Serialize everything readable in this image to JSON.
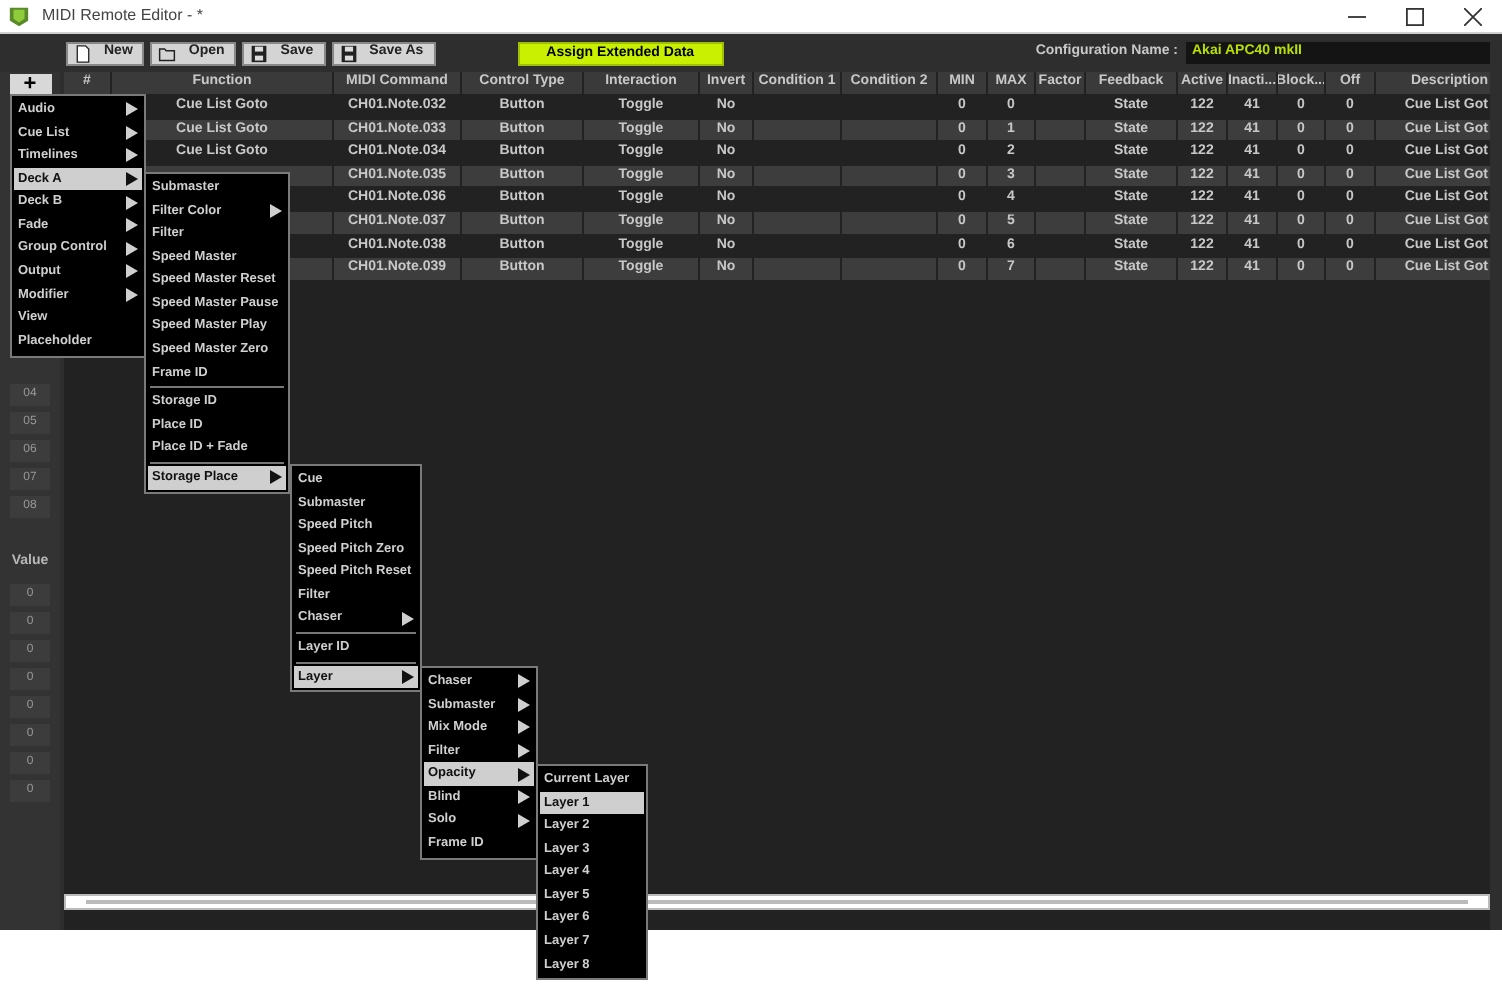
{
  "window": {
    "title": "MIDI Remote Editor - *"
  },
  "toolbar": {
    "buttons": [
      {
        "label": "New"
      },
      {
        "label": "Open"
      },
      {
        "label": "Save"
      },
      {
        "label": "Save As"
      }
    ],
    "assign_button": "Assign Extended Data",
    "configuration_label": "Configuration Name :",
    "configuration_value": "Akai APC40 mkII"
  },
  "add_button": "+",
  "row_numbers": [
    "04",
    "05",
    "06",
    "07",
    "08"
  ],
  "value_label": "Value",
  "values": [
    "0",
    "0",
    "0",
    "0",
    "0",
    "0",
    "0",
    "0"
  ],
  "table": {
    "columns": [
      "#",
      "Function",
      "MIDI Command",
      "Control Type",
      "Interaction",
      "Invert",
      "Condition 1",
      "Condition 2",
      "MIN",
      "MAX",
      "Factor",
      "Feedback",
      "Active",
      "Inacti...",
      "Block...",
      "Off",
      "Description"
    ],
    "rows": [
      {
        "function": "Cue List Goto",
        "midi": "CH01.Note.032",
        "control": "Button",
        "interaction": "Toggle",
        "invert": "No",
        "min": "0",
        "max": "0",
        "feedback": "State",
        "active": "122",
        "inactive": "41",
        "block": "0",
        "off": "0",
        "description": "Cue List Got"
      },
      {
        "function": "Cue List Goto",
        "midi": "CH01.Note.033",
        "control": "Button",
        "interaction": "Toggle",
        "invert": "No",
        "min": "0",
        "max": "1",
        "feedback": "State",
        "active": "122",
        "inactive": "41",
        "block": "0",
        "off": "0",
        "description": "Cue List Got"
      },
      {
        "function": "Cue List Goto",
        "midi": "CH01.Note.034",
        "control": "Button",
        "interaction": "Toggle",
        "invert": "No",
        "min": "0",
        "max": "2",
        "feedback": "State",
        "active": "122",
        "inactive": "41",
        "block": "0",
        "off": "0",
        "description": "Cue List Got"
      },
      {
        "midi": "CH01.Note.035",
        "control": "Button",
        "interaction": "Toggle",
        "invert": "No",
        "min": "0",
        "max": "3",
        "feedback": "State",
        "active": "122",
        "inactive": "41",
        "block": "0",
        "off": "0",
        "description": "Cue List Got"
      },
      {
        "midi": "CH01.Note.036",
        "control": "Button",
        "interaction": "Toggle",
        "invert": "No",
        "min": "0",
        "max": "4",
        "feedback": "State",
        "active": "122",
        "inactive": "41",
        "block": "0",
        "off": "0",
        "description": "Cue List Got"
      },
      {
        "midi": "CH01.Note.037",
        "control": "Button",
        "interaction": "Toggle",
        "invert": "No",
        "min": "0",
        "max": "5",
        "feedback": "State",
        "active": "122",
        "inactive": "41",
        "block": "0",
        "off": "0",
        "description": "Cue List Got"
      },
      {
        "midi": "CH01.Note.038",
        "control": "Button",
        "interaction": "Toggle",
        "invert": "No",
        "min": "0",
        "max": "6",
        "feedback": "State",
        "active": "122",
        "inactive": "41",
        "block": "0",
        "off": "0",
        "description": "Cue List Got"
      },
      {
        "midi": "CH01.Note.039",
        "control": "Button",
        "interaction": "Toggle",
        "invert": "No",
        "min": "0",
        "max": "7",
        "feedback": "State",
        "active": "122",
        "inactive": "41",
        "block": "0",
        "off": "0",
        "description": "Cue List Got"
      }
    ]
  },
  "menus": [
    {
      "items": [
        {
          "kind": "item",
          "label": "Audio",
          "submenu": true,
          "selected": false
        },
        {
          "kind": "item",
          "label": "Cue List",
          "submenu": true,
          "selected": false
        },
        {
          "kind": "item",
          "label": "Timelines",
          "submenu": true,
          "selected": false
        },
        {
          "kind": "item",
          "label": "Deck A",
          "submenu": true,
          "selected": true
        },
        {
          "kind": "item",
          "label": "Deck B",
          "submenu": true,
          "selected": false
        },
        {
          "kind": "item",
          "label": "Fade",
          "submenu": true,
          "selected": false
        },
        {
          "kind": "item",
          "label": "Group Control",
          "submenu": true,
          "selected": false
        },
        {
          "kind": "item",
          "label": "Output",
          "submenu": true,
          "selected": false
        },
        {
          "kind": "item",
          "label": "Modifier",
          "submenu": true,
          "selected": false
        },
        {
          "kind": "item",
          "label": "View",
          "submenu": false,
          "selected": false
        },
        {
          "kind": "item",
          "label": "Placeholder",
          "submenu": false,
          "selected": false
        }
      ]
    },
    {
      "items": [
        {
          "kind": "item",
          "label": "Submaster",
          "submenu": false,
          "selected": false
        },
        {
          "kind": "item",
          "label": "Filter Color",
          "submenu": true,
          "selected": false
        },
        {
          "kind": "item",
          "label": "Filter",
          "submenu": false,
          "selected": false
        },
        {
          "kind": "item",
          "label": "Speed Master",
          "submenu": false,
          "selected": false
        },
        {
          "kind": "item",
          "label": "Speed Master Reset",
          "submenu": false,
          "selected": false
        },
        {
          "kind": "item",
          "label": "Speed Master Pause",
          "submenu": false,
          "selected": false
        },
        {
          "kind": "item",
          "label": "Speed Master Play",
          "submenu": false,
          "selected": false
        },
        {
          "kind": "item",
          "label": "Speed Master Zero",
          "submenu": false,
          "selected": false
        },
        {
          "kind": "item",
          "label": "Frame ID",
          "submenu": false,
          "selected": false
        },
        {
          "kind": "separator"
        },
        {
          "kind": "item",
          "label": "Storage ID",
          "submenu": false,
          "selected": false
        },
        {
          "kind": "item",
          "label": "Place ID",
          "submenu": false,
          "selected": false
        },
        {
          "kind": "item",
          "label": "Place ID + Fade",
          "submenu": false,
          "selected": false
        },
        {
          "kind": "separator"
        },
        {
          "kind": "item",
          "label": "Storage Place",
          "submenu": true,
          "selected": true
        }
      ]
    },
    {
      "items": [
        {
          "kind": "item",
          "label": "Cue",
          "submenu": false,
          "selected": false
        },
        {
          "kind": "item",
          "label": "Submaster",
          "submenu": false,
          "selected": false
        },
        {
          "kind": "item",
          "label": "Speed Pitch",
          "submenu": false,
          "selected": false
        },
        {
          "kind": "item",
          "label": "Speed Pitch Zero",
          "submenu": false,
          "selected": false
        },
        {
          "kind": "item",
          "label": "Speed Pitch Reset",
          "submenu": false,
          "selected": false
        },
        {
          "kind": "item",
          "label": "Filter",
          "submenu": false,
          "selected": false
        },
        {
          "kind": "item",
          "label": "Chaser",
          "submenu": true,
          "selected": false
        },
        {
          "kind": "separator"
        },
        {
          "kind": "item",
          "label": "Layer ID",
          "submenu": false,
          "selected": false
        },
        {
          "kind": "separator"
        },
        {
          "kind": "item",
          "label": "Layer",
          "submenu": true,
          "selected": true
        }
      ]
    },
    {
      "items": [
        {
          "kind": "item",
          "label": "Chaser",
          "submenu": true,
          "selected": false
        },
        {
          "kind": "item",
          "label": "Submaster",
          "submenu": true,
          "selected": false
        },
        {
          "kind": "item",
          "label": "Mix Mode",
          "submenu": true,
          "selected": false
        },
        {
          "kind": "item",
          "label": "Filter",
          "submenu": true,
          "selected": false
        },
        {
          "kind": "item",
          "label": "Opacity",
          "submenu": true,
          "selected": true
        },
        {
          "kind": "item",
          "label": "Blind",
          "submenu": true,
          "selected": false
        },
        {
          "kind": "item",
          "label": "Solo",
          "submenu": true,
          "selected": false
        },
        {
          "kind": "item",
          "label": "Frame ID",
          "submenu": false,
          "selected": false
        }
      ]
    },
    {
      "items": [
        {
          "kind": "item",
          "label": "Current Layer",
          "submenu": false,
          "selected": false
        },
        {
          "kind": "item",
          "label": "Layer 1",
          "submenu": false,
          "selected": true
        },
        {
          "kind": "item",
          "label": "Layer 2",
          "submenu": false,
          "selected": false
        },
        {
          "kind": "item",
          "label": "Layer 3",
          "submenu": false,
          "selected": false
        },
        {
          "kind": "item",
          "label": "Layer 4",
          "submenu": false,
          "selected": false
        },
        {
          "kind": "item",
          "label": "Layer 5",
          "submenu": false,
          "selected": false
        },
        {
          "kind": "item",
          "label": "Layer 6",
          "submenu": false,
          "selected": false
        },
        {
          "kind": "item",
          "label": "Layer 7",
          "submenu": false,
          "selected": false
        },
        {
          "kind": "item",
          "label": "Layer 8",
          "submenu": false,
          "selected": false
        }
      ]
    }
  ]
}
